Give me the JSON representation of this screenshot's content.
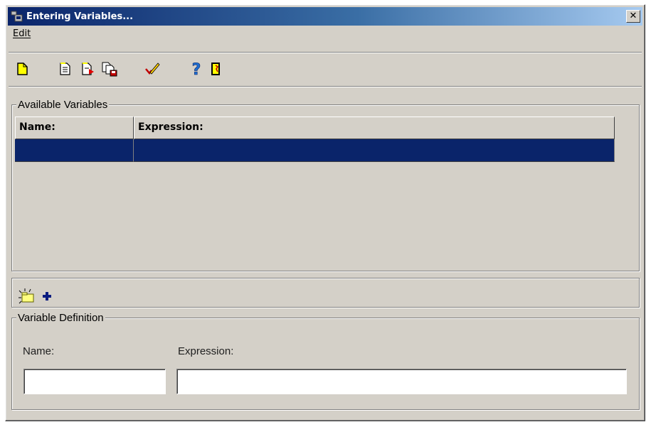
{
  "window": {
    "title": "Entering Variables...",
    "close_glyph": "✕"
  },
  "menu": {
    "items": [
      {
        "label": "Edit"
      }
    ]
  },
  "toolbar": {
    "buttons": [
      {
        "icon": "new-document-icon"
      },
      {
        "icon": "document-icon"
      },
      {
        "icon": "document-export-icon"
      },
      {
        "icon": "save-icon"
      },
      {
        "icon": "check-icon"
      },
      {
        "icon": "help-icon"
      },
      {
        "icon": "exit-icon"
      }
    ]
  },
  "available_variables": {
    "title": "Available Variables",
    "columns": [
      "Name:",
      "Expression:"
    ],
    "rows": [
      {
        "name": "",
        "expression": ""
      }
    ],
    "selected_row_color": "#0a246a"
  },
  "actions": [
    {
      "icon": "new-folder-icon"
    },
    {
      "icon": "add-icon"
    }
  ],
  "variable_definition": {
    "title": "Variable Definition",
    "name_label": "Name:",
    "expression_label": "Expression:",
    "name_value": "",
    "expression_value": ""
  }
}
